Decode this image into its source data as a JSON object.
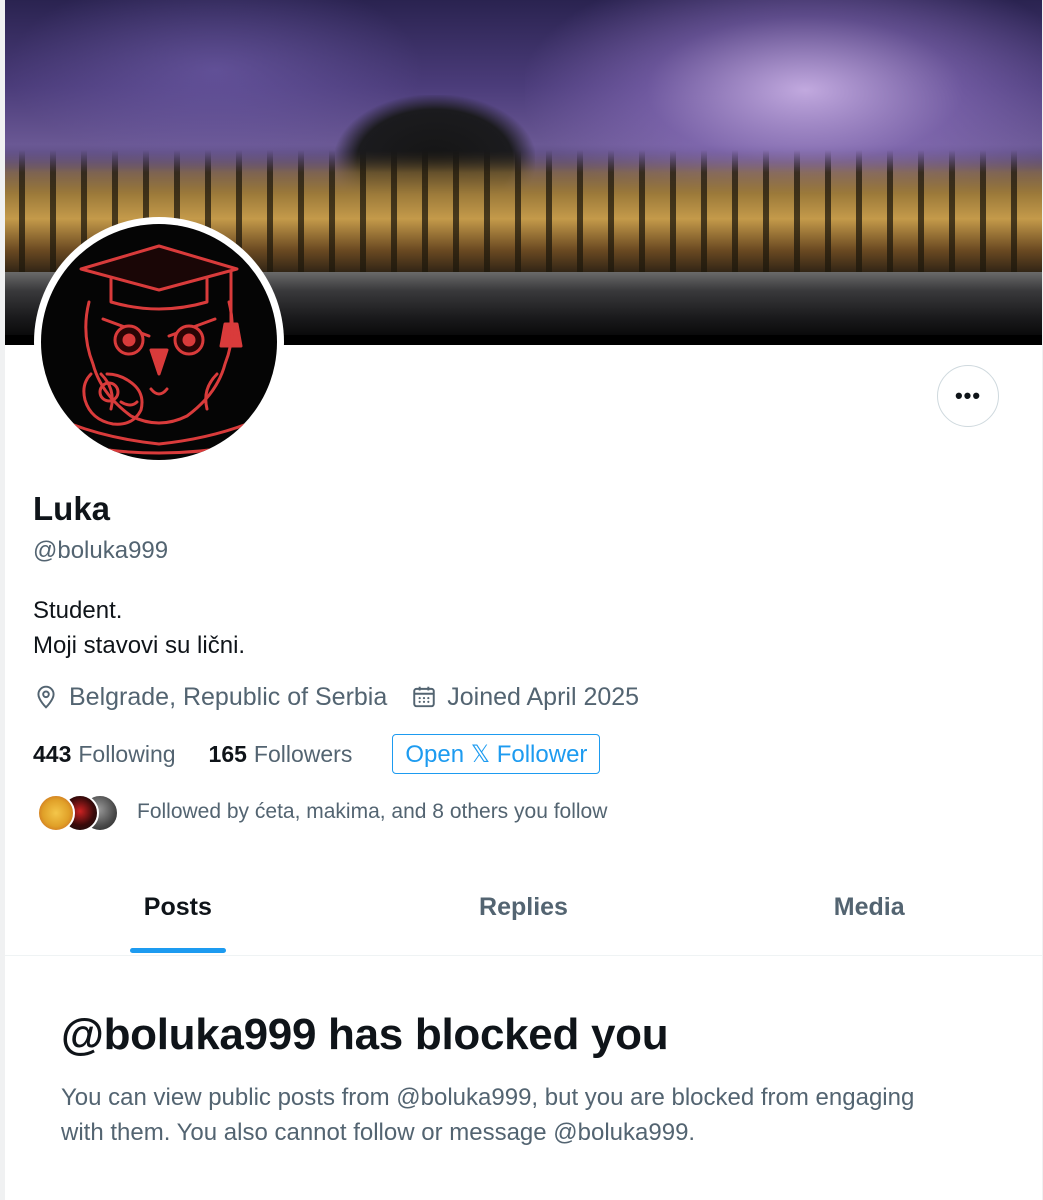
{
  "profile": {
    "display_name": "Luka",
    "handle": "@boluka999",
    "bio_line1": "Student.",
    "bio_line2": "Moji stavovi su lični.",
    "location": "Belgrade, Republic of Serbia",
    "joined": "Joined April 2025",
    "following_count": "443",
    "following_label": "Following",
    "followers_count": "165",
    "followers_label": "Followers",
    "open_follower_label": "Open 𝕏 Follower",
    "followed_by": "Followed by ćeta, makima, and 8 others you follow",
    "more_label": "•••"
  },
  "tabs": [
    {
      "label": "Posts",
      "active": true
    },
    {
      "label": "Replies",
      "active": false
    },
    {
      "label": "Media",
      "active": false
    }
  ],
  "blocked": {
    "title": "@boluka999 has blocked you",
    "body": "You can view public posts from @boluka999, but you are blocked from engaging with them. You also cannot follow or message @boluka999."
  },
  "colors": {
    "accent": "#1d9bf0",
    "secondary_text": "#536471",
    "primary_text": "#0f1419",
    "avatar_line": "#d93b3b"
  },
  "icons": {
    "location": "location-pin-icon",
    "joined": "calendar-icon",
    "more": "more-dots-icon"
  }
}
